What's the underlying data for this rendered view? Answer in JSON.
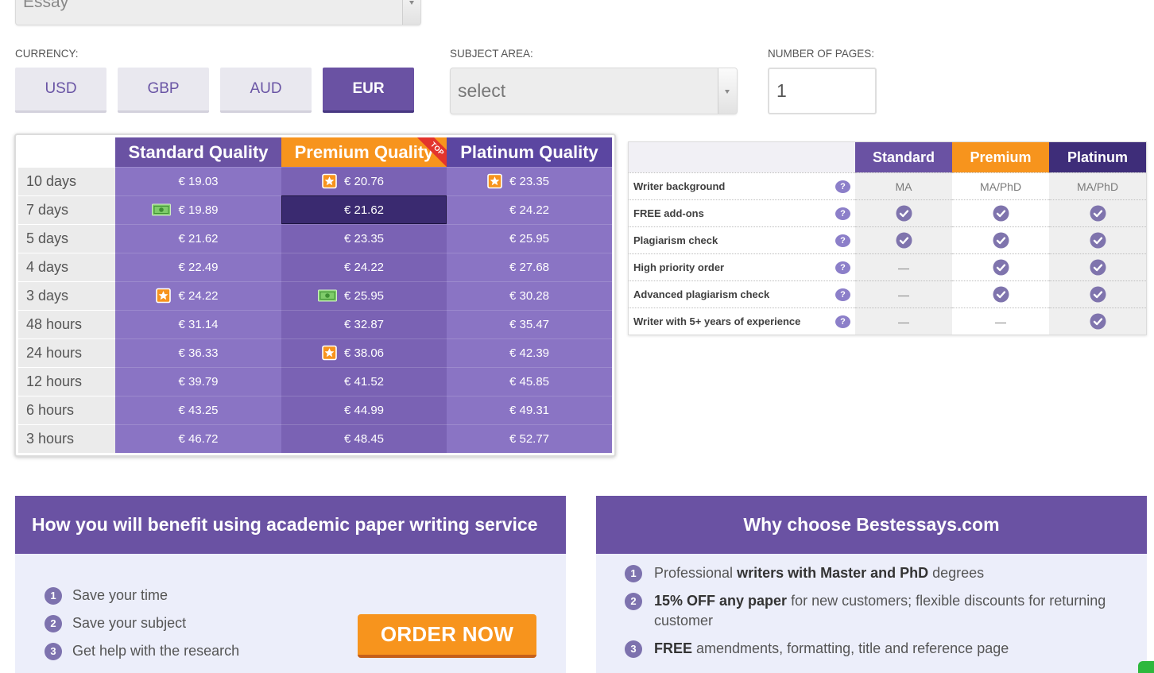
{
  "paper_type": {
    "value": "Essay"
  },
  "currency": {
    "label": "CURRENCY:",
    "options": [
      {
        "label": "USD",
        "selected": false
      },
      {
        "label": "GBP",
        "selected": false
      },
      {
        "label": "AUD",
        "selected": false
      },
      {
        "label": "EUR",
        "selected": true
      }
    ]
  },
  "subject": {
    "label": "SUBJECT AREA:",
    "value": "select"
  },
  "pages": {
    "label": "NUMBER OF PAGES:",
    "value": "1"
  },
  "pricing": {
    "headers": [
      {
        "label": "Standard Quality"
      },
      {
        "label": "Premium Quality",
        "ribbon": "TOP"
      },
      {
        "label": "Platinum Quality"
      }
    ],
    "selected_cell": {
      "row": 1,
      "col": 1
    },
    "rows": [
      {
        "deadline": "10 days",
        "prices": [
          {
            "value": "€ 19.03"
          },
          {
            "value": "€ 20.76",
            "icon": "star-icon"
          },
          {
            "value": "€ 23.35",
            "icon": "star-icon"
          }
        ]
      },
      {
        "deadline": "7 days",
        "prices": [
          {
            "value": "€ 19.89",
            "icon": "cash-icon"
          },
          {
            "value": "€ 21.62"
          },
          {
            "value": "€ 24.22"
          }
        ]
      },
      {
        "deadline": "5 days",
        "prices": [
          {
            "value": "€ 21.62"
          },
          {
            "value": "€ 23.35"
          },
          {
            "value": "€ 25.95"
          }
        ]
      },
      {
        "deadline": "4 days",
        "prices": [
          {
            "value": "€ 22.49"
          },
          {
            "value": "€ 24.22"
          },
          {
            "value": "€ 27.68"
          }
        ]
      },
      {
        "deadline": "3 days",
        "prices": [
          {
            "value": "€ 24.22",
            "icon": "star-icon"
          },
          {
            "value": "€ 25.95",
            "icon": "cash-icon"
          },
          {
            "value": "€ 30.28"
          }
        ]
      },
      {
        "deadline": "48 hours",
        "prices": [
          {
            "value": "€ 31.14"
          },
          {
            "value": "€ 32.87"
          },
          {
            "value": "€ 35.47"
          }
        ]
      },
      {
        "deadline": "24 hours",
        "prices": [
          {
            "value": "€ 36.33"
          },
          {
            "value": "€ 38.06",
            "icon": "star-icon"
          },
          {
            "value": "€ 42.39"
          }
        ]
      },
      {
        "deadline": "12 hours",
        "prices": [
          {
            "value": "€ 39.79"
          },
          {
            "value": "€ 41.52"
          },
          {
            "value": "€ 45.85"
          }
        ]
      },
      {
        "deadline": "6 hours",
        "prices": [
          {
            "value": "€ 43.25"
          },
          {
            "value": "€ 44.99"
          },
          {
            "value": "€ 49.31"
          }
        ]
      },
      {
        "deadline": "3 hours",
        "prices": [
          {
            "value": "€ 46.72"
          },
          {
            "value": "€ 48.45"
          },
          {
            "value": "€ 52.77"
          }
        ]
      }
    ]
  },
  "comparison": {
    "headers": [
      "Standard",
      "Premium",
      "Platinum"
    ],
    "help_icon": "help-icon",
    "rows": [
      {
        "label": "Writer background",
        "values": [
          "MA",
          "MA/PhD",
          "MA/PhD"
        ]
      },
      {
        "label": "FREE add-ons",
        "values": [
          "check-icon",
          "check-icon",
          "check-icon"
        ]
      },
      {
        "label": "Plagiarism check",
        "values": [
          "check-icon",
          "check-icon",
          "check-icon"
        ]
      },
      {
        "label": "High priority order",
        "values": [
          "—",
          "check-icon",
          "check-icon"
        ]
      },
      {
        "label": "Advanced plagiarism check",
        "values": [
          "—",
          "check-icon",
          "check-icon"
        ]
      },
      {
        "label": "Writer with 5+ years of experience",
        "values": [
          "—",
          "—",
          "check-icon"
        ]
      }
    ]
  },
  "benefits": {
    "title": "How you will benefit using academic paper writing service",
    "items": [
      {
        "num": "1",
        "text": "Save your time"
      },
      {
        "num": "2",
        "text": "Save your subject"
      },
      {
        "num": "3",
        "text": "Get help with the research"
      }
    ],
    "order_button": "ORDER NOW"
  },
  "why": {
    "title": "Why choose Bestessays.com",
    "items": [
      {
        "num": "1",
        "parts": [
          {
            "text": "Professional ",
            "bold": false
          },
          {
            "text": "writers with Master and PhD",
            "bold": true
          },
          {
            "text": " degrees",
            "bold": false
          }
        ]
      },
      {
        "num": "2",
        "parts": [
          {
            "text": "15% OFF any paper",
            "bold": true
          },
          {
            "text": " for new customers; flexible discounts for returning customer",
            "bold": false
          }
        ]
      },
      {
        "num": "3",
        "parts": [
          {
            "text": "FREE",
            "bold": true
          },
          {
            "text": " amendments, formatting, title and reference page",
            "bold": false
          }
        ]
      }
    ]
  },
  "colors": {
    "brand_purple": "#6a52a3",
    "premium_orange": "#f7941d",
    "platinum_purple": "#3e2d79",
    "pricing_platinum_header": "#5b46a1",
    "price_cell": "#8a74c4",
    "price_cell_premium": "#7a62b4",
    "selected_price_cell": "#3a2a70",
    "ribbon_red": "#e3342c",
    "check_purple": "#7f74ad",
    "number_purple": "#7d72ae",
    "help_purple": "#8c7fc9",
    "badge_green": "#7fcc6a",
    "panel_lavender": "#eceefa",
    "chat_widget_green": "#2db83d"
  }
}
